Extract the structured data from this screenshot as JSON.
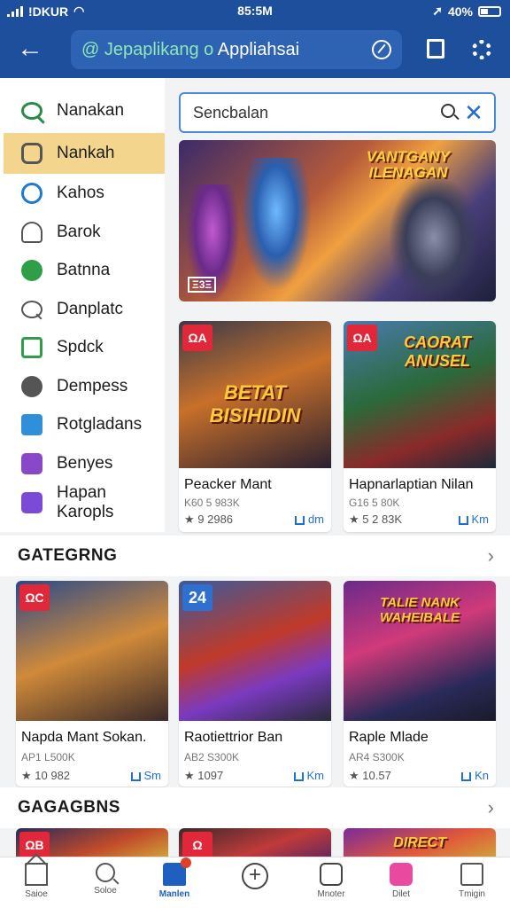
{
  "status_bar": {
    "carrier": "!DKUR",
    "time": "85:5M",
    "battery": "40%"
  },
  "app_bar": {
    "url_accent": "@ Jepaplikang o",
    "url_text": "Appliahsai"
  },
  "sidebar": {
    "items": [
      {
        "label": "Nanakan",
        "icon": "search-icon"
      },
      {
        "label": "Nankah",
        "icon": "chat-icon"
      },
      {
        "label": "Kahos",
        "icon": "globe-icon"
      },
      {
        "label": "Barok",
        "icon": "person-icon"
      },
      {
        "label": "Batnna",
        "icon": "star-icon"
      },
      {
        "label": "Danplatc",
        "icon": "search-icon"
      },
      {
        "label": "Spdck",
        "icon": "square-icon"
      },
      {
        "label": "Dempess",
        "icon": "shield-icon"
      },
      {
        "label": "Rotgladans",
        "icon": "box-icon"
      },
      {
        "label": "Benyes",
        "icon": "grid-icon"
      },
      {
        "label": "Hapan Karopls",
        "icon": "tag-icon"
      }
    ]
  },
  "search": {
    "placeholder": "Sencbalan"
  },
  "hero": {
    "title": "VANTGANY ILENAGAN",
    "logo": "Ξ3Ξ"
  },
  "featured": [
    {
      "badge": "ΩA",
      "art_title": "BETAT BISIHIDIN",
      "name": "Peacker Mant",
      "meta": "K60 5 983K",
      "rating": "★ 9 2986",
      "size": "dm"
    },
    {
      "badge": "ΩA",
      "art_title": "CAORAT ANUSEL",
      "name": "Hapnarlaptian Nilan",
      "meta": "G16 5 80K",
      "rating": "★ 5 2 83K",
      "size": "Km"
    }
  ],
  "sections": [
    {
      "title": "GATEGRNG",
      "cards": [
        {
          "badge": "ΩC",
          "art_title": "",
          "name": "Napda Mant Sokan.",
          "meta": "AP1 L500K",
          "rating": "★ 10 982",
          "size": "Sm"
        },
        {
          "badge": "24",
          "art_title": "",
          "name": "Raotiettrior Ban",
          "meta": "AB2 S300K",
          "rating": "★ 1097",
          "size": "Km"
        },
        {
          "badge": "",
          "art_title": "TALIE NANK  WAHEIBALE",
          "name": "Raple Mlade",
          "meta": "AR4 S300K",
          "rating": "★ 10.57",
          "size": "Kn"
        }
      ]
    },
    {
      "title": "GAGAGBNS",
      "cards": [
        {
          "badge": "ΩB"
        },
        {
          "badge": "Ω"
        },
        {
          "badge": "",
          "art_title": "DIRECT"
        }
      ]
    }
  ],
  "bottom_nav": [
    {
      "label": "Saioe",
      "icon": "home-icon"
    },
    {
      "label": "Soloe",
      "icon": "search-icon"
    },
    {
      "label": "Manlen",
      "icon": "apps-icon"
    },
    {
      "label": "",
      "icon": "plus-icon"
    },
    {
      "label": "Mnoter",
      "icon": "box-icon"
    },
    {
      "label": "Dilet",
      "icon": "pink-icon"
    },
    {
      "label": "Tmigin",
      "icon": "doc-icon"
    }
  ],
  "colors": {
    "primary": "#1e4f9c",
    "active_sidebar": "#f4d58e",
    "link": "#1f6fd1",
    "badge_red": "#e0283a"
  }
}
